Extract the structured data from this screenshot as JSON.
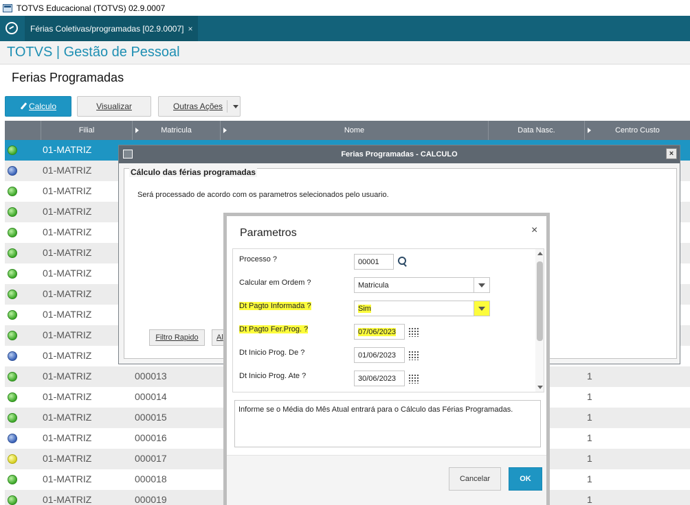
{
  "window": {
    "title": "TOTVS Educacional (TOTVS) 02.9.0007"
  },
  "tabs": [
    {
      "label": "Férias Coletivas/programadas [02.9.0007]",
      "close": "×"
    }
  ],
  "module": {
    "title": "TOTVS | Gestão de Pessoal"
  },
  "page": {
    "title": "Ferias Programadas"
  },
  "toolbar": {
    "calculo": "Calculo",
    "visualizar": "Visualizar",
    "outras_acoes": "Outras Ações"
  },
  "grid": {
    "columns": [
      "Filial",
      "Matricula",
      "Nome",
      "Data Nasc.",
      "Centro Custo"
    ],
    "rows": [
      {
        "status": "green",
        "filial": "01-MATRIZ",
        "matricula": "",
        "cc": ""
      },
      {
        "status": "blue",
        "filial": "01-MATRIZ",
        "matricula": "",
        "cc": ""
      },
      {
        "status": "green",
        "filial": "01-MATRIZ",
        "matricula": "",
        "cc": ""
      },
      {
        "status": "green",
        "filial": "01-MATRIZ",
        "matricula": "",
        "cc": ""
      },
      {
        "status": "green",
        "filial": "01-MATRIZ",
        "matricula": "",
        "cc": ""
      },
      {
        "status": "green",
        "filial": "01-MATRIZ",
        "matricula": "",
        "cc": ""
      },
      {
        "status": "green",
        "filial": "01-MATRIZ",
        "matricula": "",
        "cc": ""
      },
      {
        "status": "green",
        "filial": "01-MATRIZ",
        "matricula": "",
        "cc": ""
      },
      {
        "status": "green",
        "filial": "01-MATRIZ",
        "matricula": "",
        "cc": ""
      },
      {
        "status": "green",
        "filial": "01-MATRIZ",
        "matricula": "",
        "cc": ""
      },
      {
        "status": "blue",
        "filial": "01-MATRIZ",
        "matricula": "",
        "cc": ""
      },
      {
        "status": "green",
        "filial": "01-MATRIZ",
        "matricula": "000013",
        "cc": "1"
      },
      {
        "status": "green",
        "filial": "01-MATRIZ",
        "matricula": "000014",
        "cc": "1"
      },
      {
        "status": "green",
        "filial": "01-MATRIZ",
        "matricula": "000015",
        "cc": "1"
      },
      {
        "status": "blue",
        "filial": "01-MATRIZ",
        "matricula": "000016",
        "cc": "1"
      },
      {
        "status": "yellow",
        "filial": "01-MATRIZ",
        "matricula": "000017",
        "cc": "1"
      },
      {
        "status": "green",
        "filial": "01-MATRIZ",
        "matricula": "000018",
        "cc": "1"
      },
      {
        "status": "green",
        "filial": "01-MATRIZ",
        "matricula": "000019",
        "cc": "1"
      }
    ]
  },
  "calc_dialog": {
    "title": "Ferias Programadas - CALCULO",
    "close": "×",
    "group": "Cálculo das férias programadas",
    "text": "Será processado de acordo com os parametros selecionados pelo usuario.",
    "filtro": "Filtro Rapido",
    "partial_button": "Al"
  },
  "param_dialog": {
    "title": "Parametros",
    "close": "×",
    "fields": [
      {
        "label": "Processo ?",
        "value": "00001"
      },
      {
        "label": "Calcular em Ordem ?",
        "value": "Matricula"
      },
      {
        "label": "Dt Pagto Informada ?",
        "value": "Sim"
      },
      {
        "label": "Dt Pagto Fer.Prog. ?",
        "value": "07/06/2023"
      },
      {
        "label": "Dt Inicio Prog. De ?",
        "value": "01/06/2023"
      },
      {
        "label": "Dt Inicio Prog. Ate ?",
        "value": "30/06/2023"
      }
    ],
    "help": "Informe se o Média do Mês Atual entrará para o Cálculo das Férias Programadas.",
    "cancel": "Cancelar",
    "ok": "OK"
  },
  "colors": {
    "teal": "#13627a",
    "accent": "#1e95c3",
    "highlight": "#fcfc3c"
  }
}
